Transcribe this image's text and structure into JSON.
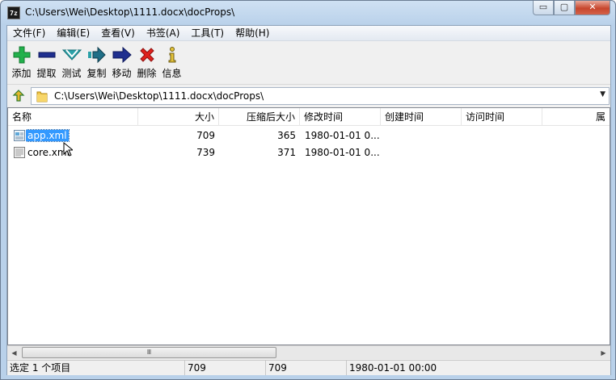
{
  "window": {
    "title": "C:\\Users\\Wei\\Desktop\\1111.docx\\docProps\\",
    "app_icon_text": "7z",
    "min_glyph": "▭",
    "max_glyph": "▢",
    "close_glyph": "✕"
  },
  "menu": [
    "文件(F)",
    "编辑(E)",
    "查看(V)",
    "书签(A)",
    "工具(T)",
    "帮助(H)"
  ],
  "toolbar": {
    "add": "添加",
    "extract": "提取",
    "test": "测试",
    "copy": "复制",
    "move": "移动",
    "delete": "删除",
    "info": "信息"
  },
  "address": {
    "path": "C:\\Users\\Wei\\Desktop\\1111.docx\\docProps\\",
    "dropdown_glyph": "▼"
  },
  "columns": [
    "名称",
    "大小",
    "压缩后大小",
    "修改时间",
    "创建时间",
    "访问时间",
    "属"
  ],
  "files": [
    {
      "name": "app.xml",
      "size": "709",
      "packed": "365",
      "modified": "1980-01-01 0...",
      "created": "",
      "accessed": "",
      "selected": true
    },
    {
      "name": "core.xml",
      "size": "739",
      "packed": "371",
      "modified": "1980-01-01 0...",
      "created": "",
      "accessed": "",
      "selected": false
    }
  ],
  "scrollbar": {
    "left_arrow": "◀",
    "right_arrow": "▶",
    "grip": "Ⅲ"
  },
  "status": {
    "selection": "选定 1 个项目",
    "size": "709",
    "packed": "709",
    "modified": "1980-01-01 00:00"
  },
  "colors": {
    "selection": "#3399ff",
    "add_icon": "#22b14c",
    "delete_icon": "#e0201b",
    "toolbar_blue": "#1f2f8f",
    "toolbar_teal": "#2aa1a8"
  }
}
